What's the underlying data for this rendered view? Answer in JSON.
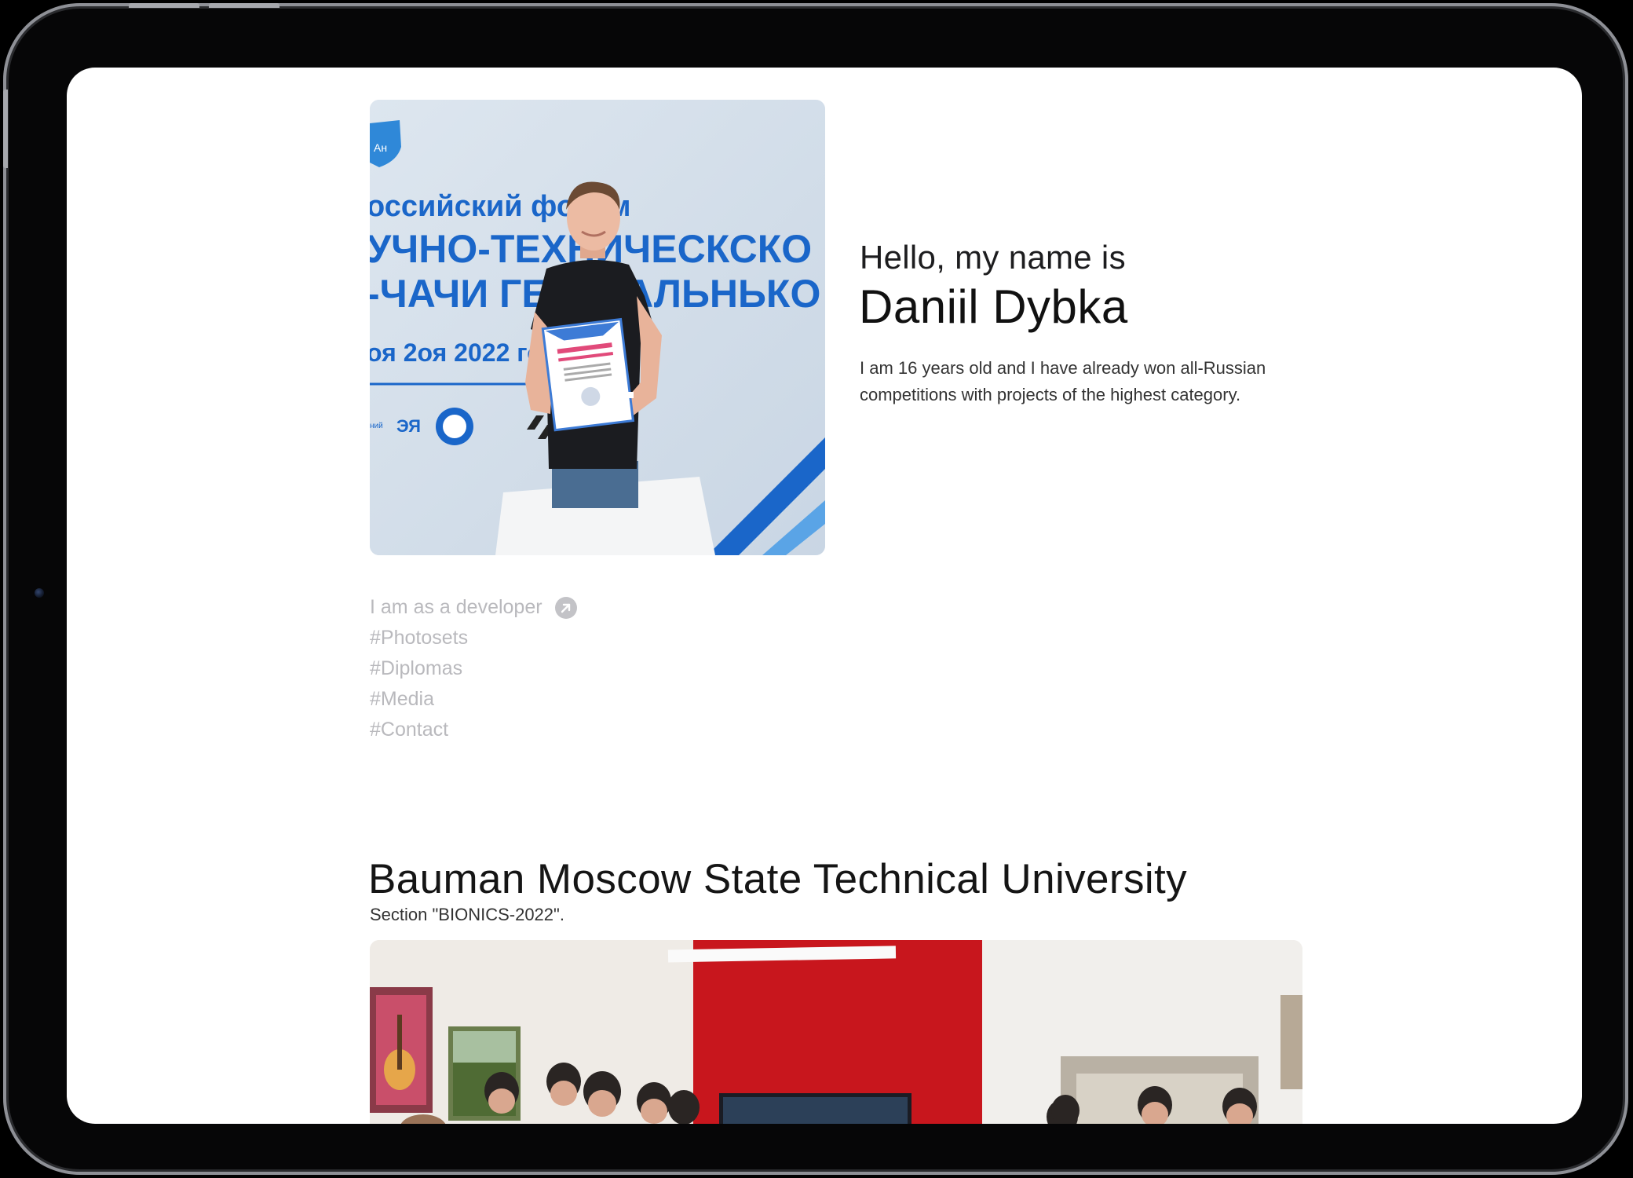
{
  "hero": {
    "greeting": "Hello, my name is",
    "name": "Daniil Dybka",
    "bio": "I am 16 years old and I have already won all-Russian competitions with projects of the highest category.",
    "photo": {
      "banner_lines": [
        "оссийский форум",
        "УЧНО-ТЕХНИЧЕСКСКО",
        "-ЧАЧИ ГЕНЕРАЛЬНЬКО",
        "оя 2оя 2022 го"
      ]
    }
  },
  "nav": {
    "developer_label": "I am as a developer",
    "developer_icon": "arrow-up-right-circle-icon",
    "items": [
      "#Photosets",
      "#Diplomas",
      "#Media",
      "#Contact"
    ]
  },
  "section": {
    "title": "Bauman Moscow State Technical University",
    "subtitle": "Section \"BIONICS-2022\"."
  },
  "colors": {
    "banner_blue": "#1a66c9",
    "muted_nav": "#b9b9bd",
    "wall_red": "#c8161d"
  }
}
